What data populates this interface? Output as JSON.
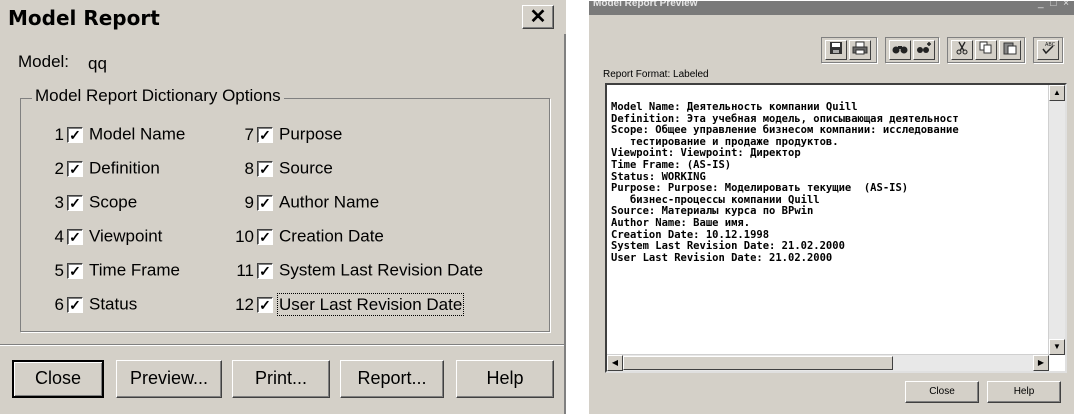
{
  "dialog": {
    "title": "Model Report",
    "close_glyph": "✕",
    "model_label": "Model:",
    "model_value": "qq",
    "group_title": "Model Report Dictionary Options",
    "options": [
      {
        "num": "1",
        "label": "Model Name",
        "checked": true
      },
      {
        "num": "2",
        "label": "Definition",
        "checked": true
      },
      {
        "num": "3",
        "label": "Scope",
        "checked": true
      },
      {
        "num": "4",
        "label": "Viewpoint",
        "checked": true
      },
      {
        "num": "5",
        "label": "Time Frame",
        "checked": true
      },
      {
        "num": "6",
        "label": "Status",
        "checked": true
      },
      {
        "num": "7",
        "label": "Purpose",
        "checked": true
      },
      {
        "num": "8",
        "label": "Source",
        "checked": true
      },
      {
        "num": "9",
        "label": "Author Name",
        "checked": true
      },
      {
        "num": "10",
        "label": "Creation Date",
        "checked": true
      },
      {
        "num": "11",
        "label": "System Last Revision Date",
        "checked": true
      },
      {
        "num": "12",
        "label": "User Last Revision Date",
        "checked": true
      }
    ],
    "check_glyph": "✓",
    "buttons": {
      "close": "Close",
      "preview": "Preview...",
      "print": "Print...",
      "report": "Report...",
      "help": "Help"
    }
  },
  "preview": {
    "title": "Model Report Preview",
    "window_controls": "_ □ ×",
    "report_format_label": "Report Format: Labeled",
    "toolbar_icons": [
      "save-icon",
      "print-icon",
      "find-icon",
      "find-next-icon",
      "cut-icon",
      "copy-icon",
      "paste-icon",
      "spell-check-icon"
    ],
    "lines": [
      "Model Name: Деятельность компании Quill",
      "Definition: Эта учебная модель, описывающая деятельност",
      "Scope: Общее управление бизнесом компании: исследование",
      "   тестирование и продаже продуктов.",
      "Viewpoint: Viewpoint: Директор",
      "Time Frame: (AS-IS)",
      "Status: WORKING",
      "Purpose: Purpose: Моделировать текущие  (AS-IS)",
      "   бизнес-процессы компании Quill",
      "Source: Материалы курса по BPwin",
      "Author Name: Ваше имя.",
      "Creation Date: 10.12.1998",
      "System Last Revision Date: 21.02.2000",
      "User Last Revision Date: 21.02.2000"
    ],
    "buttons": {
      "close": "Close",
      "help": "Help"
    }
  }
}
